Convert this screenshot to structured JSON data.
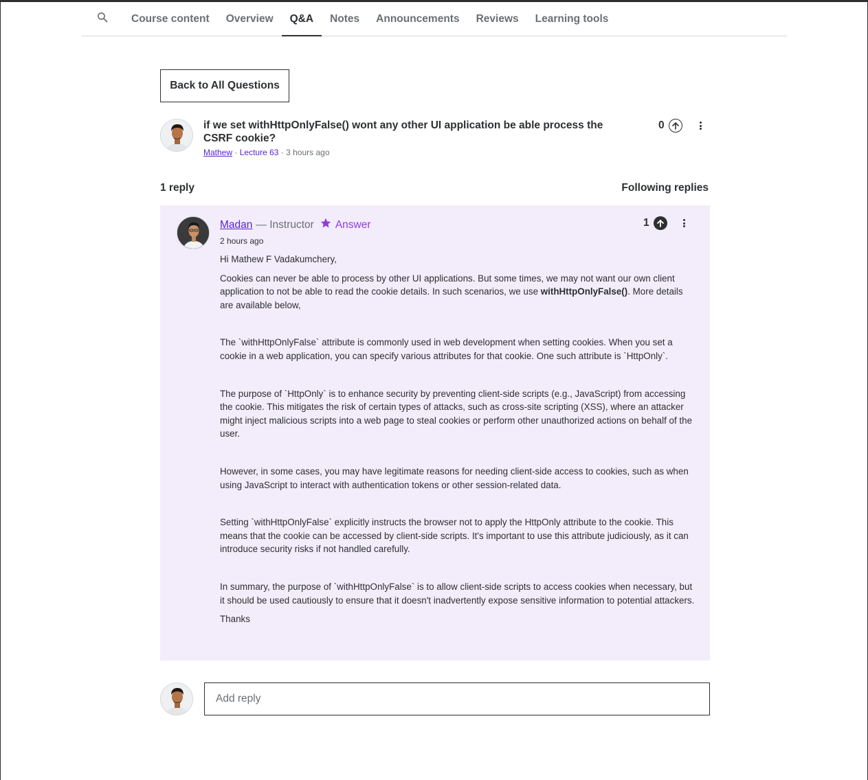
{
  "nav": {
    "tabs": [
      {
        "label": "Course content"
      },
      {
        "label": "Overview"
      },
      {
        "label": "Q&A"
      },
      {
        "label": "Notes"
      },
      {
        "label": "Announcements"
      },
      {
        "label": "Reviews"
      },
      {
        "label": "Learning tools"
      }
    ],
    "active_tab": "Q&A"
  },
  "back_button": "Back to All Questions",
  "question": {
    "title": "if we set withHttpOnlyFalse() wont any other UI application be able process the CSRF cookie?",
    "author": "Mathew",
    "lecture": "Lecture 63",
    "time": "3 hours ago",
    "separator": "·",
    "votes": "0"
  },
  "replies": {
    "count_label": "1 reply",
    "following_label": "Following replies"
  },
  "answer": {
    "author": "Madan",
    "role": "— Instructor",
    "badge": "Answer",
    "time": "2 hours ago",
    "votes": "1",
    "greeting": "Hi Mathew F Vadakumchery,",
    "p1_before": "Cookies can never be able to process by other UI applications. But some times, we may not want our own client application to not be able to read the cookie details. In such scenarios, we use ",
    "p1_bold": "withHttpOnlyFalse()",
    "p1_after": ". More details are available below,",
    "p2": "The `withHttpOnlyFalse` attribute is commonly used in web development when setting cookies. When you set a cookie in a web application, you can specify various attributes for that cookie. One such attribute is `HttpOnly`.",
    "p3": "The purpose of `HttpOnly` is to enhance security by preventing client-side scripts (e.g., JavaScript) from accessing the cookie. This mitigates the risk of certain types of attacks, such as cross-site scripting (XSS), where an attacker might inject malicious scripts into a web page to steal cookies or perform other unauthorized actions on behalf of the user.",
    "p4": "However, in some cases, you may have legitimate reasons for needing client-side access to cookies, such as when using JavaScript to interact with authentication tokens or other session-related data.",
    "p5": "Setting `withHttpOnlyFalse` explicitly instructs the browser not to apply the HttpOnly attribute to the cookie. This means that the cookie can be accessed by client-side scripts. It's important to use this attribute judiciously, as it can introduce security risks if not handled carefully.",
    "p6": "In summary, the purpose of `withHttpOnlyFalse` is to allow client-side scripts to access cookies when necessary, but it should be used cautiously to ensure that it doesn't inadvertently expose sensitive information to potential attackers.",
    "signoff": "Thanks"
  },
  "reply_box": {
    "placeholder": "Add reply"
  },
  "icons": {
    "search": "search-icon",
    "upvote": "upvote-arrow-icon",
    "more": "more-options-icon",
    "star": "star-icon"
  },
  "colors": {
    "accent_purple": "#5624d0",
    "badge_purple": "#8f3ed9",
    "answer_bg": "#f3ecfb",
    "text_dark": "#2d2f31",
    "text_muted": "#6a6f73"
  }
}
